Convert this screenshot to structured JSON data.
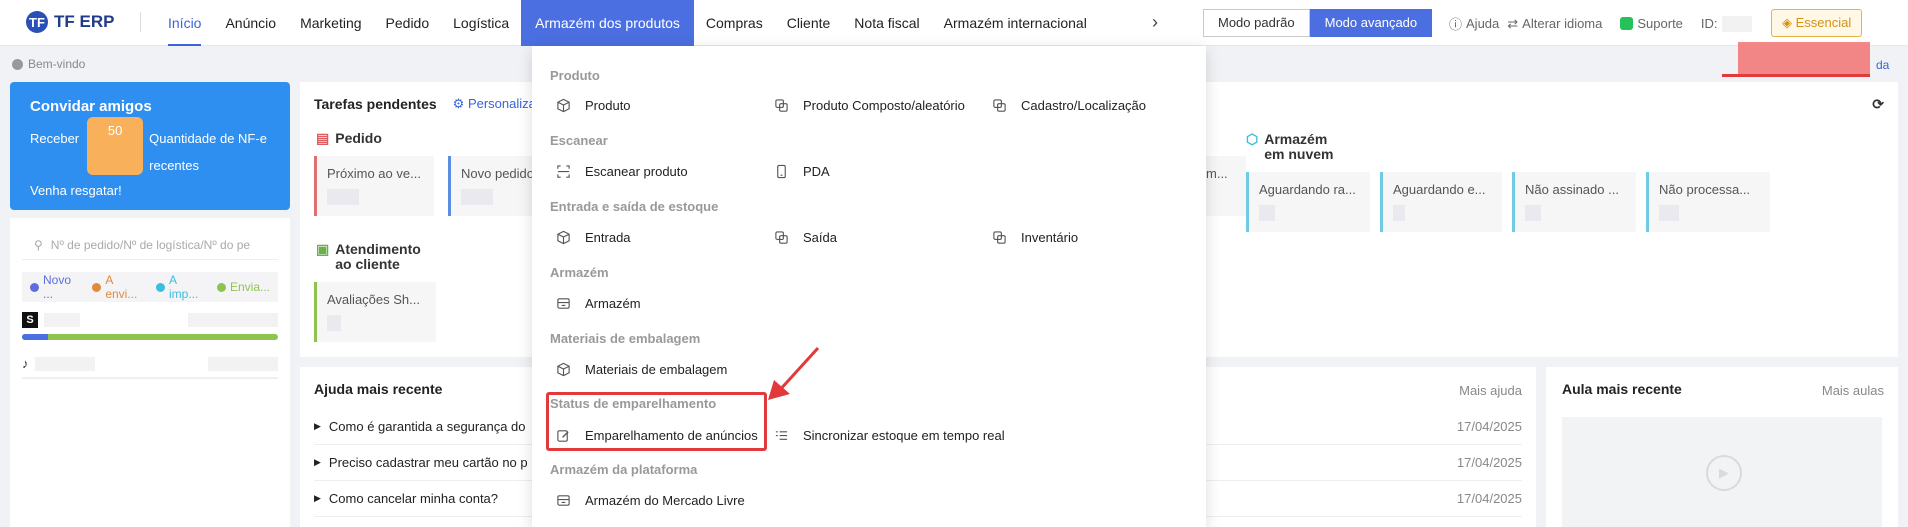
{
  "app": {
    "logo_text": "TF ERP",
    "logo_mark": "TF"
  },
  "nav": {
    "items": [
      "Início",
      "Anúncio",
      "Marketing",
      "Pedido",
      "Logística",
      "Armazém dos produtos",
      "Compras",
      "Cliente",
      "Nota fiscal",
      "Armazém internacional"
    ],
    "more": "›"
  },
  "modes": {
    "standard": "Modo padrão",
    "advanced": "Modo avançado"
  },
  "toplinks": {
    "help": "Ajuda",
    "language": "Alterar idioma",
    "support": "Suporte",
    "id_label": "ID:"
  },
  "plan_badge": "Essencial",
  "overflow_link": "da",
  "welcome": "Bem-vindo",
  "invite": {
    "title": "Convidar amigos",
    "receive": "Receber",
    "amount": "50",
    "desc_line1": "Quantidade de NF-e",
    "desc_line2": "recentes",
    "cta": "Venha resgatar!"
  },
  "order_search": {
    "placeholder": "Nº de pedido/Nº de logística/Nº do pe",
    "chips": [
      {
        "label": "Novo ...",
        "color": "#5b6ee0"
      },
      {
        "label": "A envi...",
        "color": "#e08a3c"
      },
      {
        "label": "A imp...",
        "color": "#3cbde0"
      },
      {
        "label": "Envia...",
        "color": "#8ec34f"
      }
    ],
    "shops": [
      {
        "icon": "S",
        "progress": 0.1
      },
      {
        "icon": "♪"
      }
    ]
  },
  "tasks": {
    "title": "Tarefas pendentes",
    "customize": "Personalizar",
    "sections": {
      "order": "Pedido",
      "service": "Atendimento ao cliente",
      "cloud": "Armazém em nuvem"
    },
    "order_cards": [
      "Próximo ao ve...",
      "Novo pedido"
    ],
    "partial_card": "m...",
    "service_cards": [
      "Avaliações Sh..."
    ],
    "cloud_cards": [
      "Aguardando ra...",
      "Aguardando e...",
      "Não assinado ...",
      "Não processa..."
    ]
  },
  "help": {
    "title": "Ajuda mais recente",
    "more": "Mais ajuda",
    "rows": [
      {
        "q": "Como é garantida a segurança do",
        "date": "17/04/2025"
      },
      {
        "q": "Preciso cadastrar meu cartão no p",
        "date": "17/04/2025"
      },
      {
        "q": "Como cancelar minha conta?",
        "date": "17/04/2025"
      }
    ]
  },
  "aula": {
    "title": "Aula mais recente",
    "more": "Mais aulas"
  },
  "dropdown": {
    "groups": [
      "Produto",
      "Escanear",
      "Entrada e saída de estoque",
      "Armazém",
      "Materiais de embalagem",
      "Status de emparelhamento",
      "Armazém da plataforma"
    ],
    "items": {
      "produto": "Produto",
      "composto": "Produto Composto/aleatório",
      "cadastro": "Cadastro/Localização",
      "escanear": "Escanear produto",
      "pda": "PDA",
      "entrada": "Entrada",
      "saida": "Saída",
      "inventario": "Inventário",
      "armazem": "Armazém",
      "materiais": "Materiais de embalagem",
      "emparelhamento": "Emparelhamento de anúncios",
      "sincronizar": "Sincronizar estoque em tempo real",
      "mercado": "Armazém do Mercado Livre"
    }
  },
  "colors": {
    "accent": "#4b6fe0",
    "highlight": "#e23a3a",
    "invite_bg": "#2e8ff0"
  }
}
